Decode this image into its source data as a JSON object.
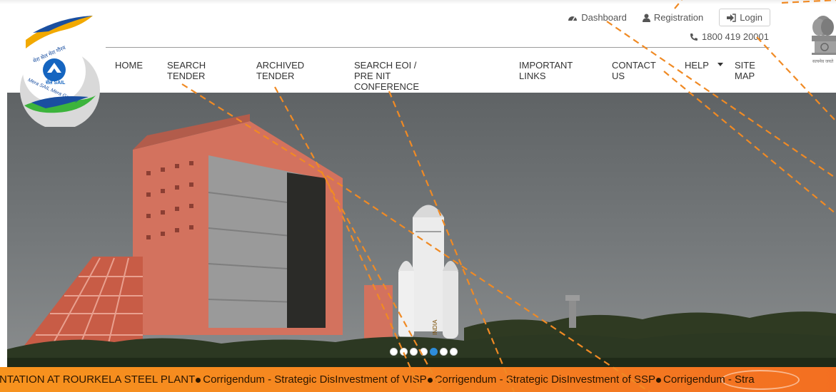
{
  "header": {
    "utility_links": [
      {
        "label": "Dashboard",
        "icon": "dashboard-icon"
      },
      {
        "label": "Registration",
        "icon": "user-icon"
      }
    ],
    "login": {
      "label": "Login",
      "icon": "sign-in-icon"
    },
    "phone": {
      "number": "1800 419 20001",
      "icon": "phone-icon"
    }
  },
  "logo": {
    "top_text": "मेरा सेल मेरा गौरव",
    "center_text": "सेल SAIL",
    "bottom_text": "Mera SAIL Mera Gaurav",
    "emblem_caption": "सत्यमेव जयते"
  },
  "nav": {
    "items": [
      {
        "label": "HOME"
      },
      {
        "label": "SEARCH\nTENDER"
      },
      {
        "label": "ARCHIVED\nTENDER"
      },
      {
        "label": "SEARCH EOI / PRE NIT\nCONFERENCE"
      },
      {
        "label": "IMPORTANT\nLINKS"
      },
      {
        "label": "CONTACT\nUS"
      },
      {
        "label": "HELP"
      },
      {
        "label": "SITE\nMAP"
      }
    ]
  },
  "hero": {
    "rocket_text": "INDIA",
    "slides": 7,
    "active_slide": 5
  },
  "ticker": {
    "items": [
      "NTATION AT ROURKELA STEEL PLANT",
      "Corrigendum - Strategic DisInvestment of VISP",
      "Corrigendum - Strategic DisInvestment of SSP",
      "Corrigendum - Stra"
    ]
  },
  "colors": {
    "accent": "#f58220",
    "dot_active": "#2e8ddb",
    "sail_blue": "#1565c0"
  }
}
